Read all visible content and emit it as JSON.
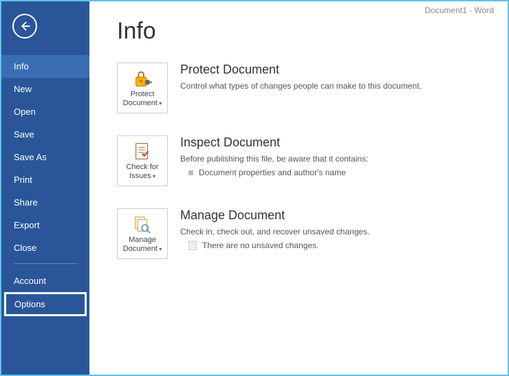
{
  "titlebar": "Document1 - Word",
  "sidebar": {
    "items": [
      {
        "label": "Info",
        "active": true
      },
      {
        "label": "New"
      },
      {
        "label": "Open"
      },
      {
        "label": "Save"
      },
      {
        "label": "Save As"
      },
      {
        "label": "Print"
      },
      {
        "label": "Share"
      },
      {
        "label": "Export"
      },
      {
        "label": "Close"
      }
    ],
    "bottom_items": [
      {
        "label": "Account"
      },
      {
        "label": "Options",
        "highlighted": true
      }
    ]
  },
  "main": {
    "title": "Info",
    "sections": {
      "protect": {
        "tile_label": "Protect Document",
        "title": "Protect Document",
        "desc": "Control what types of changes people can make to this document."
      },
      "inspect": {
        "tile_label": "Check for Issues",
        "title": "Inspect Document",
        "desc": "Before publishing this file, be aware that it contains:",
        "list_item": "Document properties and author's name"
      },
      "manage": {
        "tile_label": "Manage Document",
        "title": "Manage Document",
        "desc": "Check in, check out, and recover unsaved changes.",
        "list_item": "There are no unsaved changes."
      }
    }
  }
}
